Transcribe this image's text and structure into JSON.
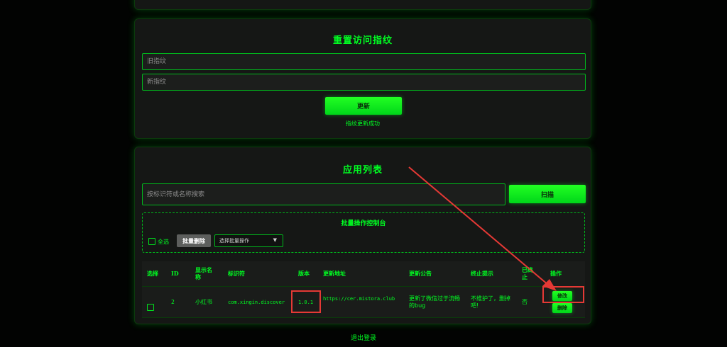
{
  "reset": {
    "title": "重置访问指纹",
    "old_placeholder": "旧指纹",
    "new_placeholder": "新指纹",
    "update_label": "更新",
    "message": "指纹更新成功"
  },
  "apps": {
    "title": "应用列表",
    "search_placeholder": "按标识符或名称搜索",
    "scan_label": "扫描",
    "batch": {
      "title": "批量操作控制台",
      "select_all": "全选",
      "batch_delete": "批量删除",
      "select_value": "选择批量操作"
    },
    "columns": {
      "select": "选择",
      "id": "ID",
      "name": "显示名称",
      "identifier": "标识符",
      "version": "版本",
      "url": "更新地址",
      "notice": "更新公告",
      "stop_hint": "终止提示",
      "stopped": "已终止",
      "actions": "操作"
    },
    "rows": [
      {
        "id": "2",
        "name": "小红书",
        "identifier": "com.xingin.discover",
        "version": "1.0.1",
        "url": "https://cer.mistora.club",
        "notice": "更新了微信过于流畅的bug",
        "stop_hint": "不维护了，删掉吧!",
        "stopped": "否",
        "edit_label": "修改",
        "delete_label": "删除"
      }
    ]
  },
  "logout_label": "退出登录",
  "colors": {
    "accent": "#00ff22",
    "panel_bg": "#151715",
    "highlight": "#e53935"
  }
}
